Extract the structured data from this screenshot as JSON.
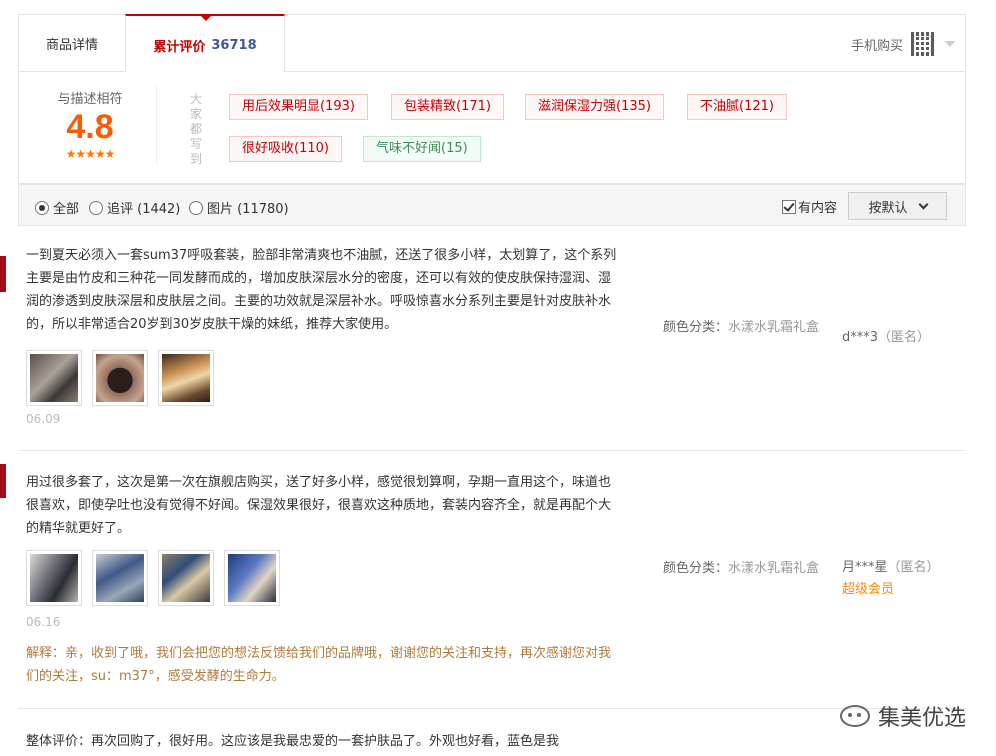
{
  "tabs": {
    "details": "商品详情",
    "reviews": "累计评价",
    "review_count": "36718",
    "mobile_buy": "手机购买"
  },
  "rating": {
    "label": "与描述相符",
    "score": "4.8",
    "stars": "★★★★★",
    "everyone_says": [
      "大",
      "家",
      "都",
      "写",
      "到"
    ]
  },
  "tags": [
    {
      "label": "用后效果明显(193)",
      "tone": "positive"
    },
    {
      "label": "包装精致(171)",
      "tone": "positive"
    },
    {
      "label": "滋润保湿力强(135)",
      "tone": "positive"
    },
    {
      "label": "不油腻(121)",
      "tone": "positive"
    },
    {
      "label": "很好吸收(110)",
      "tone": "positive"
    },
    {
      "label": "气味不好闻(15)",
      "tone": "negative"
    }
  ],
  "filter": {
    "all": "全部",
    "followup": "追评 (1442)",
    "images": "图片 (11780)",
    "has_content": "有内容",
    "sort": "按默认"
  },
  "reviews": [
    {
      "text": "一到夏天必须入一套sum37呼吸套装，脸部非常清爽也不油腻，还送了很多小样，太划算了，这个系列主要是由竹皮和三种花一同发酵而成的，增加皮肤深层水分的密度，还可以有效的使皮肤保持湿润、湿润的渗透到皮肤深层和皮肤层之间。主要的功效就是深层补水。呼吸惊喜水分系列主要是针对皮肤补水的，所以非常适合20岁到30岁皮肤干燥的妹纸，推荐大家使用。",
      "date": "06.09",
      "spec_label": "颜色分类：",
      "spec_value": "水漾水乳霜礼盒",
      "user": "d***3",
      "anon": "（匿名）",
      "vip": "",
      "reply": ""
    },
    {
      "text": "用过很多套了，这次是第一次在旗舰店购买，送了好多小样，感觉很划算啊，孕期一直用这个，味道也很喜欢，即使孕吐也没有觉得不好闻。保湿效果很好，很喜欢这种质地，套装内容齐全，就是再配个大的精华就更好了。",
      "date": "06.16",
      "spec_label": "颜色分类：",
      "spec_value": "水漾水乳霜礼盒",
      "user": "月***星",
      "anon": "（匿名）",
      "vip": "超级会员",
      "reply": "解释：亲，收到了哦，我们会把您的想法反馈给我们的品牌哦，谢谢您的关注和支持，再次感谢您对我们的关注，su：m37°，感受发酵的生命力。"
    },
    {
      "text": "整体评价：再次回购了，很好用。这应该是我最忠爱的一套护肤品了。外观也好看，蓝色是我"
    }
  ],
  "watermark": {
    "brand": "集美优选"
  }
}
